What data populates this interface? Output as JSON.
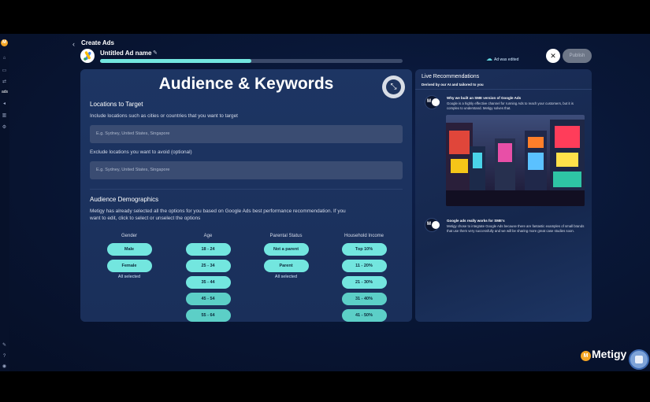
{
  "rail": {
    "logo_letter": "M",
    "icons": [
      "home-icon",
      "box-icon",
      "share-icon",
      "ads-icon",
      "megaphone-icon",
      "chart-icon",
      "gear-icon",
      "help-icon",
      "user-icon"
    ],
    "active_label": "ads"
  },
  "header": {
    "back_glyph": "‹",
    "breadcrumb": "Create Ads",
    "ad_name": "Untitled Ad name",
    "progress_percent": 50,
    "saved_status": "Ad was edited",
    "publish_label": "Publish"
  },
  "main": {
    "title": "Audience & Keywords",
    "locations": {
      "heading": "Locations to Target",
      "include_desc": "Include locations such as cities or countries that you want to target",
      "include_placeholder": "E.g. Sydney, United States, Singapore",
      "exclude_desc": "Exclude locations you want to avoid (optional)",
      "exclude_placeholder": "E.g. Sydney, United States, Singapore"
    },
    "demographics": {
      "heading": "Audience Demographics",
      "desc_line1": "Metigy has already selected all the options for you based on Google Ads best performance recommendation. If you",
      "desc_line2": "want to edit, click to select or unselect the options",
      "gender": {
        "label": "Gender",
        "options": [
          "Male",
          "Female"
        ],
        "note": "All selected"
      },
      "age": {
        "label": "Age",
        "options": [
          "18 - 24",
          "25 - 34",
          "35 - 44",
          "45 - 54",
          "55 - 64"
        ]
      },
      "parental": {
        "label": "Parental Status",
        "options": [
          "Not a parent",
          "Parent"
        ],
        "note": "All selected"
      },
      "income": {
        "label": "Household Income",
        "options": [
          "Top 10%",
          "11 - 20%",
          "21 - 30%",
          "31 - 40%",
          "41 - 50%"
        ]
      }
    }
  },
  "side": {
    "title": "Live Recommendations",
    "subtitle": "Derived by our AI and tailored to you",
    "messages": [
      {
        "avatar_letter": "M",
        "title": "Why we built an SME version of Google Ads",
        "body": "Google is a highly effective channel for running Ads to reach your customers, but it is complex to understand. Metigy solves that."
      },
      {
        "avatar_letter": "M",
        "title": "Google ads really works for SME's",
        "body": "Metigy chose to integrate Google Ads because there are fantastic examples of small brands that use them very successfully and we will be sharing more great case studies soon."
      }
    ]
  },
  "brand": {
    "name": "Metigy",
    "dot_letter": "M"
  },
  "colors": {
    "accent": "#73e6df",
    "brand": "#f5a524",
    "panel": "#1d3563"
  }
}
